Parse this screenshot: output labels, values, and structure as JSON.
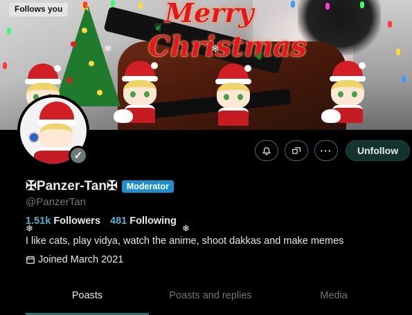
{
  "banner": {
    "follows_you": "Follows you",
    "greeting_line1": "Merry",
    "greeting_line2": "Christmas"
  },
  "profile": {
    "display_name": "✠Panzer-Tan✠",
    "role_badge": "Moderator",
    "handle": "@PanzerTan",
    "followers_count": "1.51k",
    "followers_label": "Followers",
    "following_count": "481",
    "following_label": "Following",
    "bio": "I like cats, play vidya, watch the anime, shoot dakkas and make memes",
    "joined": "Joined March 2021"
  },
  "actions": {
    "notify_icon": "bell-icon",
    "message_icon": "chat-icon",
    "more_icon": "ellipsis-icon",
    "unfollow_label": "Unfollow"
  },
  "tabs": [
    {
      "label": "Poasts",
      "active": true
    },
    {
      "label": "Poasts and replies",
      "active": false
    },
    {
      "label": "Media",
      "active": false
    }
  ],
  "colors": {
    "accent": "#4fb3c9",
    "moderator_badge": "#1d8ecf",
    "unfollow_bg": "#12332e",
    "tab_indicator": "#2b6f6a"
  }
}
